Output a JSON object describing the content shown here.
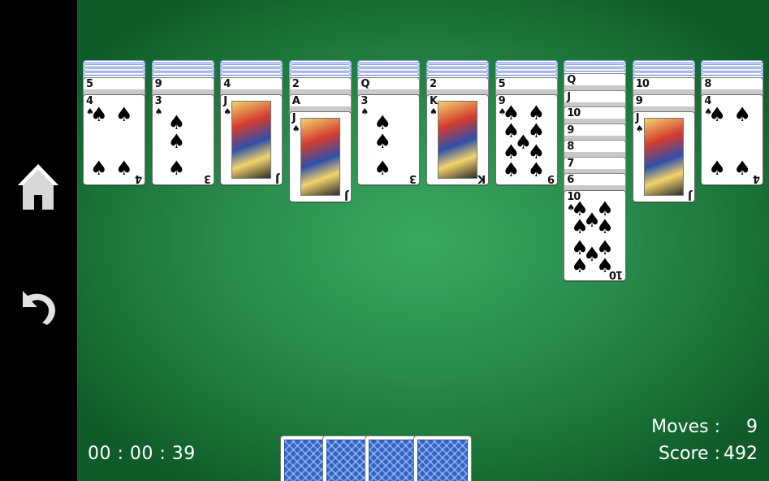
{
  "sidebar": {
    "home_icon": "home-icon",
    "undo_icon": "undo-icon"
  },
  "status": {
    "timer": "00 : 00 : 39",
    "moves_label": "Moves :",
    "moves_value": "9",
    "score_label": "Score :",
    "score_value": "492"
  },
  "colors": {
    "felt_center": "#3aa862",
    "felt_edge": "#0f5b2a",
    "card_back": "#2f63c9",
    "sidebar": "#000000"
  },
  "tableau": [
    {
      "hidden": 4,
      "partial": [
        {
          "rank": "5"
        }
      ],
      "top": {
        "rank": "4",
        "suit": "♠"
      }
    },
    {
      "hidden": 4,
      "partial": [
        {
          "rank": "9"
        }
      ],
      "top": {
        "rank": "3",
        "suit": "♠"
      }
    },
    {
      "hidden": 4,
      "partial": [
        {
          "rank": "4"
        }
      ],
      "top": {
        "rank": "J",
        "suit": "♠",
        "face": true
      }
    },
    {
      "hidden": 4,
      "partial": [
        {
          "rank": "2"
        },
        {
          "rank": "A"
        }
      ],
      "top": {
        "rank": "J",
        "suit": "♠",
        "face": true
      }
    },
    {
      "hidden": 4,
      "partial": [
        {
          "rank": "Q"
        }
      ],
      "top": {
        "rank": "3",
        "suit": "♠"
      }
    },
    {
      "hidden": 4,
      "partial": [
        {
          "rank": "2"
        }
      ],
      "top": {
        "rank": "K",
        "suit": "♠",
        "face": true
      }
    },
    {
      "hidden": 4,
      "partial": [
        {
          "rank": "5"
        }
      ],
      "top": {
        "rank": "9",
        "suit": "♠"
      }
    },
    {
      "hidden": 3,
      "partial": [
        {
          "rank": "Q"
        },
        {
          "rank": "J"
        },
        {
          "rank": "10"
        },
        {
          "rank": "9"
        },
        {
          "rank": "8"
        },
        {
          "rank": "7"
        },
        {
          "rank": "6"
        }
      ],
      "top": {
        "rank": "10",
        "suit": "♠"
      }
    },
    {
      "hidden": 4,
      "partial": [
        {
          "rank": "10"
        },
        {
          "rank": "9"
        }
      ],
      "top": {
        "rank": "J",
        "suit": "♠",
        "face": true
      }
    },
    {
      "hidden": 4,
      "partial": [
        {
          "rank": "8"
        }
      ],
      "top": {
        "rank": "4",
        "suit": "♠"
      }
    }
  ],
  "stock_piles": 4
}
